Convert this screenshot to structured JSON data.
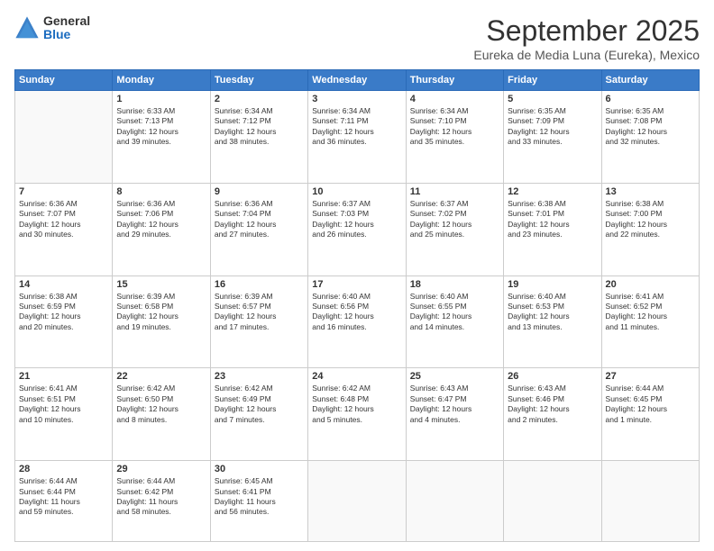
{
  "logo": {
    "general": "General",
    "blue": "Blue"
  },
  "header": {
    "month": "September 2025",
    "location": "Eureka de Media Luna (Eureka), Mexico"
  },
  "days_of_week": [
    "Sunday",
    "Monday",
    "Tuesday",
    "Wednesday",
    "Thursday",
    "Friday",
    "Saturday"
  ],
  "weeks": [
    [
      {
        "day": "",
        "info": ""
      },
      {
        "day": "1",
        "info": "Sunrise: 6:33 AM\nSunset: 7:13 PM\nDaylight: 12 hours\nand 39 minutes."
      },
      {
        "day": "2",
        "info": "Sunrise: 6:34 AM\nSunset: 7:12 PM\nDaylight: 12 hours\nand 38 minutes."
      },
      {
        "day": "3",
        "info": "Sunrise: 6:34 AM\nSunset: 7:11 PM\nDaylight: 12 hours\nand 36 minutes."
      },
      {
        "day": "4",
        "info": "Sunrise: 6:34 AM\nSunset: 7:10 PM\nDaylight: 12 hours\nand 35 minutes."
      },
      {
        "day": "5",
        "info": "Sunrise: 6:35 AM\nSunset: 7:09 PM\nDaylight: 12 hours\nand 33 minutes."
      },
      {
        "day": "6",
        "info": "Sunrise: 6:35 AM\nSunset: 7:08 PM\nDaylight: 12 hours\nand 32 minutes."
      }
    ],
    [
      {
        "day": "7",
        "info": "Sunrise: 6:36 AM\nSunset: 7:07 PM\nDaylight: 12 hours\nand 30 minutes."
      },
      {
        "day": "8",
        "info": "Sunrise: 6:36 AM\nSunset: 7:06 PM\nDaylight: 12 hours\nand 29 minutes."
      },
      {
        "day": "9",
        "info": "Sunrise: 6:36 AM\nSunset: 7:04 PM\nDaylight: 12 hours\nand 27 minutes."
      },
      {
        "day": "10",
        "info": "Sunrise: 6:37 AM\nSunset: 7:03 PM\nDaylight: 12 hours\nand 26 minutes."
      },
      {
        "day": "11",
        "info": "Sunrise: 6:37 AM\nSunset: 7:02 PM\nDaylight: 12 hours\nand 25 minutes."
      },
      {
        "day": "12",
        "info": "Sunrise: 6:38 AM\nSunset: 7:01 PM\nDaylight: 12 hours\nand 23 minutes."
      },
      {
        "day": "13",
        "info": "Sunrise: 6:38 AM\nSunset: 7:00 PM\nDaylight: 12 hours\nand 22 minutes."
      }
    ],
    [
      {
        "day": "14",
        "info": "Sunrise: 6:38 AM\nSunset: 6:59 PM\nDaylight: 12 hours\nand 20 minutes."
      },
      {
        "day": "15",
        "info": "Sunrise: 6:39 AM\nSunset: 6:58 PM\nDaylight: 12 hours\nand 19 minutes."
      },
      {
        "day": "16",
        "info": "Sunrise: 6:39 AM\nSunset: 6:57 PM\nDaylight: 12 hours\nand 17 minutes."
      },
      {
        "day": "17",
        "info": "Sunrise: 6:40 AM\nSunset: 6:56 PM\nDaylight: 12 hours\nand 16 minutes."
      },
      {
        "day": "18",
        "info": "Sunrise: 6:40 AM\nSunset: 6:55 PM\nDaylight: 12 hours\nand 14 minutes."
      },
      {
        "day": "19",
        "info": "Sunrise: 6:40 AM\nSunset: 6:53 PM\nDaylight: 12 hours\nand 13 minutes."
      },
      {
        "day": "20",
        "info": "Sunrise: 6:41 AM\nSunset: 6:52 PM\nDaylight: 12 hours\nand 11 minutes."
      }
    ],
    [
      {
        "day": "21",
        "info": "Sunrise: 6:41 AM\nSunset: 6:51 PM\nDaylight: 12 hours\nand 10 minutes."
      },
      {
        "day": "22",
        "info": "Sunrise: 6:42 AM\nSunset: 6:50 PM\nDaylight: 12 hours\nand 8 minutes."
      },
      {
        "day": "23",
        "info": "Sunrise: 6:42 AM\nSunset: 6:49 PM\nDaylight: 12 hours\nand 7 minutes."
      },
      {
        "day": "24",
        "info": "Sunrise: 6:42 AM\nSunset: 6:48 PM\nDaylight: 12 hours\nand 5 minutes."
      },
      {
        "day": "25",
        "info": "Sunrise: 6:43 AM\nSunset: 6:47 PM\nDaylight: 12 hours\nand 4 minutes."
      },
      {
        "day": "26",
        "info": "Sunrise: 6:43 AM\nSunset: 6:46 PM\nDaylight: 12 hours\nand 2 minutes."
      },
      {
        "day": "27",
        "info": "Sunrise: 6:44 AM\nSunset: 6:45 PM\nDaylight: 12 hours\nand 1 minute."
      }
    ],
    [
      {
        "day": "28",
        "info": "Sunrise: 6:44 AM\nSunset: 6:44 PM\nDaylight: 11 hours\nand 59 minutes."
      },
      {
        "day": "29",
        "info": "Sunrise: 6:44 AM\nSunset: 6:42 PM\nDaylight: 11 hours\nand 58 minutes."
      },
      {
        "day": "30",
        "info": "Sunrise: 6:45 AM\nSunset: 6:41 PM\nDaylight: 11 hours\nand 56 minutes."
      },
      {
        "day": "",
        "info": ""
      },
      {
        "day": "",
        "info": ""
      },
      {
        "day": "",
        "info": ""
      },
      {
        "day": "",
        "info": ""
      }
    ]
  ]
}
